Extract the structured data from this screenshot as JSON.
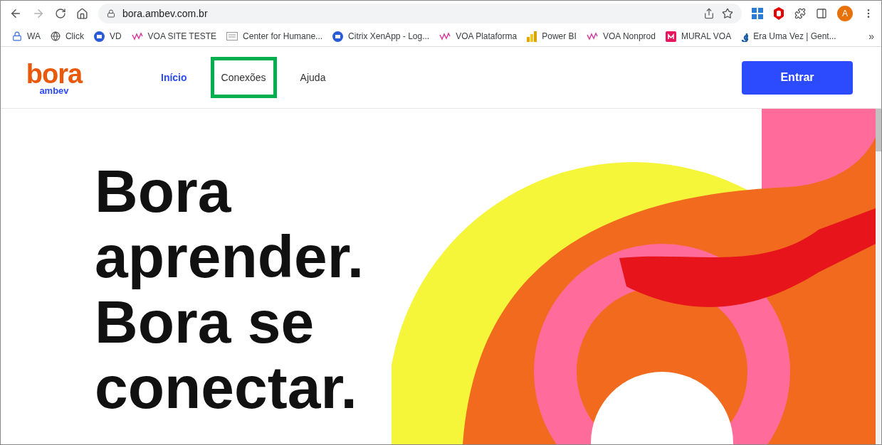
{
  "browser": {
    "url": "bora.ambev.com.br",
    "profile_initial": "A",
    "bookmarks": [
      {
        "label": "WA",
        "kind": "lock"
      },
      {
        "label": "Click",
        "kind": "globe"
      },
      {
        "label": "VD",
        "kind": "citrix"
      },
      {
        "label": "VOA SITE TESTE",
        "kind": "voa"
      },
      {
        "label": "Center for Humane...",
        "kind": "doc"
      },
      {
        "label": "Citrix XenApp - Log...",
        "kind": "citrix"
      },
      {
        "label": "VOA Plataforma",
        "kind": "voa"
      },
      {
        "label": "Power BI",
        "kind": "powerbi"
      },
      {
        "label": "VOA Nonprod",
        "kind": "voa"
      },
      {
        "label": "MURAL VOA",
        "kind": "mural"
      },
      {
        "label": "Era Uma Vez | Gent...",
        "kind": "g"
      }
    ],
    "more": "»"
  },
  "site": {
    "logo": {
      "brand": "bora",
      "sub": "ambev"
    },
    "nav": [
      {
        "label": "Início",
        "selected": true,
        "highlighted": false
      },
      {
        "label": "Conexões",
        "selected": false,
        "highlighted": true
      },
      {
        "label": "Ajuda",
        "selected": false,
        "highlighted": false
      }
    ],
    "login_button": "Entrar",
    "hero": {
      "lines": [
        "Bora",
        "aprender.",
        "Bora se",
        "conectar."
      ]
    }
  }
}
